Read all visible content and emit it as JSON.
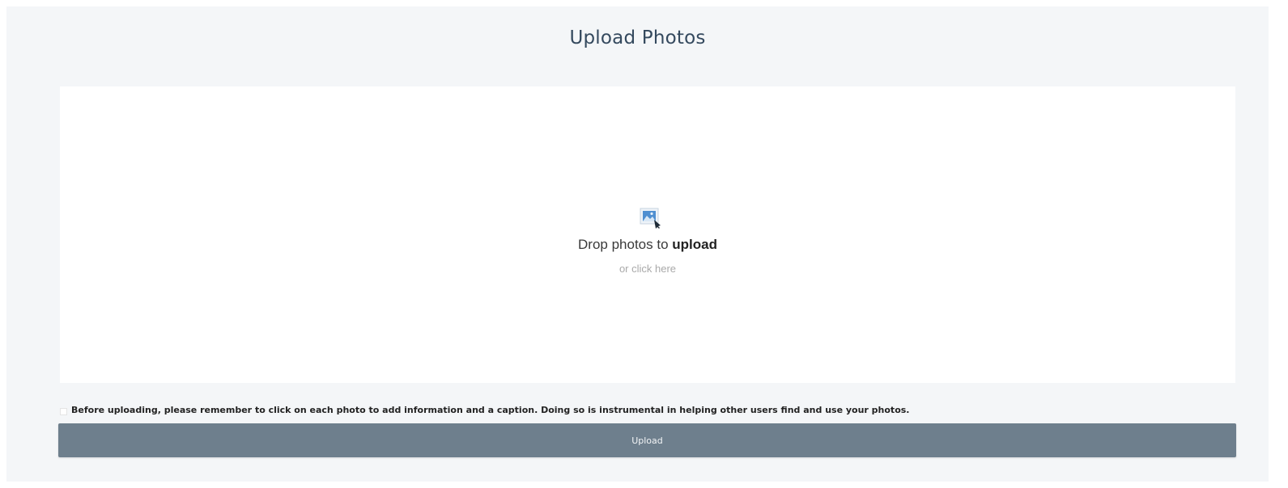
{
  "page": {
    "title": "Upload Photos"
  },
  "dropzone": {
    "icon": "image-upload-icon",
    "line_prefix": "Drop photos to ",
    "line_emphasis": "upload",
    "secondary": "or click here"
  },
  "notice": {
    "text": "Before uploading, please remember to click on each photo to add information and a caption. Doing so is instrumental in helping other users find and use your photos."
  },
  "actions": {
    "upload_label": "Upload"
  },
  "colors": {
    "background": "#f4f6f8",
    "dropzone": "#ffffff",
    "button": "#6e7f8d",
    "title": "#34495e"
  }
}
